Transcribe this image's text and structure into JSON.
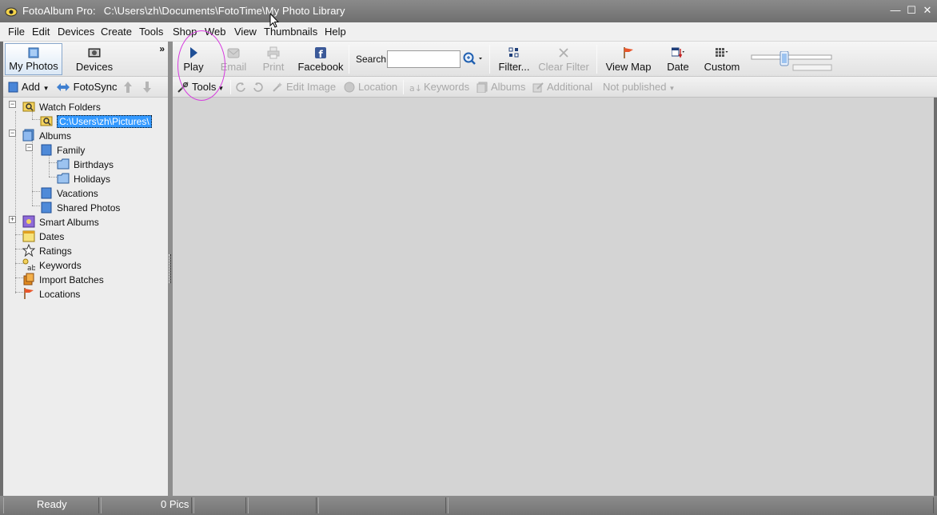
{
  "window": {
    "app_name": "FotoAlbum Pro:",
    "path": "C:\\Users\\zh\\Documents\\FotoTime\\My Photo Library",
    "minimize": "—",
    "maximize": "☐",
    "close": "✕"
  },
  "menu": {
    "items": [
      {
        "label": "File"
      },
      {
        "label": "Edit"
      },
      {
        "label": "Devices"
      },
      {
        "label": "Create"
      },
      {
        "label": "Tools"
      },
      {
        "label": "Shop"
      },
      {
        "label": "Web"
      },
      {
        "label": "View"
      },
      {
        "label": "Thumbnails"
      },
      {
        "label": "Help"
      }
    ]
  },
  "left_pane": {
    "tabs": [
      {
        "label": "My Photos",
        "active": true
      },
      {
        "label": "Devices",
        "active": false
      }
    ],
    "chevron": "»",
    "tools": {
      "add": "Add",
      "fotosync": "FotoSync"
    },
    "tree": {
      "watch_folders": "Watch Folders",
      "watch_path": "C:\\Users\\zh\\Pictures\\",
      "albums": "Albums",
      "family": "Family",
      "birthdays": "Birthdays",
      "holidays": "Holidays",
      "vacations": "Vacations",
      "shared_photos": "Shared Photos",
      "smart_albums": "Smart Albums",
      "dates": "Dates",
      "ratings": "Ratings",
      "keywords": "Keywords",
      "import_batches": "Import Batches",
      "locations": "Locations"
    }
  },
  "toolbar": {
    "play": "Play",
    "email": "Email",
    "print": "Print",
    "facebook": "Facebook",
    "search_label": "Search",
    "search_value": "",
    "filter": "Filter...",
    "clear_filter": "Clear Filter",
    "view_map": "View Map",
    "date": "Date",
    "custom": "Custom",
    "thumbnail_size_fraction": 0.4
  },
  "secondary_toolbar": {
    "tools": "Tools",
    "edit_image": "Edit Image",
    "location": "Location",
    "keywords": "Keywords",
    "albums": "Albums",
    "additional": "Additional",
    "published": "Not published"
  },
  "statusbar": {
    "status": "Ready",
    "pics": "0 Pics"
  },
  "colors": {
    "titlebar": "#7c7c7c",
    "highlight_ring": "#d63adf",
    "selection": "#3399ff",
    "facebook": "#3b5998"
  }
}
